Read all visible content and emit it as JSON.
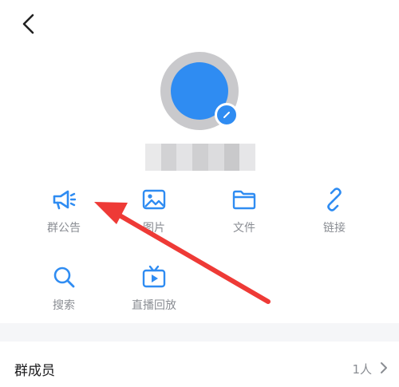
{
  "header": {
    "back_icon": "chevron-left-icon"
  },
  "profile": {
    "avatar_color": "#2f8cf2",
    "avatar_ring_color": "#c9c9cc",
    "edit_icon": "pencil-icon"
  },
  "actions": [
    {
      "label": "群公告",
      "icon": "megaphone-icon"
    },
    {
      "label": "图片",
      "icon": "image-icon"
    },
    {
      "label": "文件",
      "icon": "folder-icon"
    },
    {
      "label": "链接",
      "icon": "link-icon"
    },
    {
      "label": "搜索",
      "icon": "search-icon"
    },
    {
      "label": "直播回放",
      "icon": "tv-icon"
    }
  ],
  "members": {
    "label": "群成员",
    "count": "1人"
  },
  "colors": {
    "accent": "#2f8cf2",
    "annotation_arrow": "#ee3a36"
  }
}
